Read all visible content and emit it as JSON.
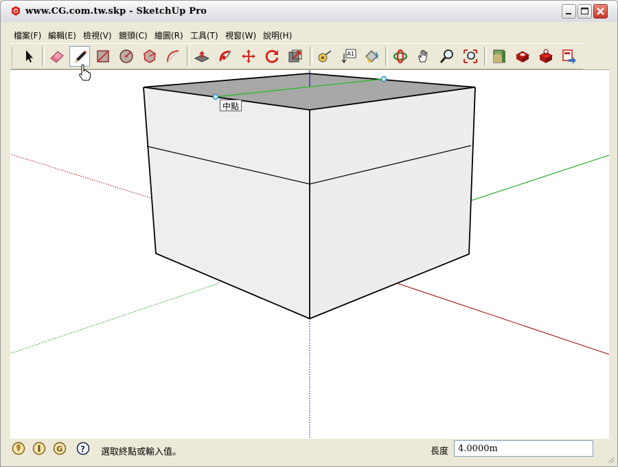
{
  "window": {
    "title": "www.CG.com.tw.skp - SketchUp Pro",
    "app_icon": "sketchup-icon",
    "controls": [
      "minimize-icon",
      "maximize-icon",
      "close-icon"
    ]
  },
  "menu": [
    {
      "label": "檔案(F)"
    },
    {
      "label": "編輯(E)"
    },
    {
      "label": "檢視(V)"
    },
    {
      "label": "鏡頭(C)"
    },
    {
      "label": "繪圖(R)"
    },
    {
      "label": "工具(T)"
    },
    {
      "label": "視窗(W)"
    },
    {
      "label": "說明(H)"
    }
  ],
  "toolbar": {
    "tools": [
      {
        "icon": "select-arrow-icon"
      },
      {
        "icon": "eraser-icon"
      },
      {
        "icon": "pencil-line-icon",
        "active": true
      },
      {
        "icon": "rectangle-icon"
      },
      {
        "icon": "circle-icon"
      },
      {
        "icon": "polygon-icon"
      },
      {
        "icon": "arc-icon"
      },
      {
        "icon": "push-pull-icon"
      },
      {
        "icon": "follow-me-icon"
      },
      {
        "icon": "move-icon"
      },
      {
        "icon": "rotate-icon"
      },
      {
        "icon": "scale-icon"
      },
      {
        "icon": "tape-measure-icon"
      },
      {
        "icon": "text-icon",
        "label": "A1"
      },
      {
        "icon": "paint-bucket-icon"
      },
      {
        "icon": "orbit-icon"
      },
      {
        "icon": "pan-icon"
      },
      {
        "icon": "zoom-icon"
      },
      {
        "icon": "zoom-extents-icon"
      },
      {
        "icon": "google-earth-icon"
      },
      {
        "icon": "get-models-icon"
      },
      {
        "icon": "share-model-icon"
      },
      {
        "icon": "export-3d-icon"
      }
    ]
  },
  "viewport": {
    "inference_tooltip": "中點",
    "colors": {
      "red_axis": "#a00000",
      "green_axis": "#00a000",
      "blue_axis": "#0000c0",
      "box_face": "#eeeeee",
      "box_top": "#a8a8a8",
      "edge": "#000000",
      "inference_point": "#33a0d0"
    }
  },
  "status": {
    "icons": [
      "geo-location-icon",
      "credits-icon",
      "signin-icon",
      "help-icon"
    ],
    "message": "選取終點或輸入值。",
    "vcb_label": "長度",
    "vcb_value": "4.0000m"
  }
}
